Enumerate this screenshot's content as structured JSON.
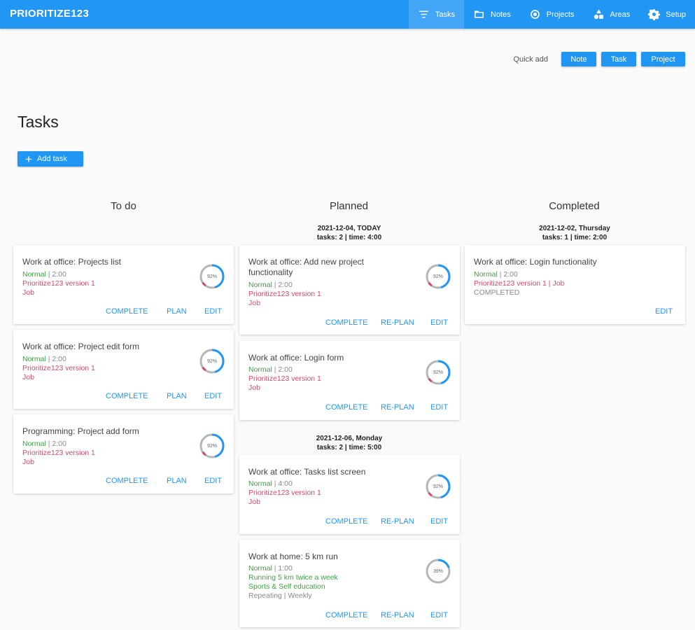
{
  "app": {
    "title": "PRIORITIZE123"
  },
  "nav": [
    {
      "label": "Tasks",
      "icon": "filter-icon",
      "active": true
    },
    {
      "label": "Notes",
      "icon": "folder-icon",
      "active": false
    },
    {
      "label": "Projects",
      "icon": "target-icon",
      "active": false
    },
    {
      "label": "Areas",
      "icon": "shapes-icon",
      "active": false
    },
    {
      "label": "Setup",
      "icon": "gear-icon",
      "active": false
    }
  ],
  "quick_add": {
    "label": "Quick add",
    "buttons": [
      "Note",
      "Task",
      "Project"
    ]
  },
  "page": {
    "title": "Tasks",
    "add_task": "Add task"
  },
  "columns": {
    "todo": "To do",
    "planned": "Planned",
    "completed": "Completed"
  },
  "todo": [
    {
      "title": "Work at office: Projects list",
      "priority": "Normal",
      "sep": " | ",
      "time": "2:00",
      "project": "Prioritize123 version 1",
      "area": "Job",
      "progress": "92%",
      "actions": [
        "COMPLETE",
        "PLAN",
        "EDIT"
      ]
    },
    {
      "title": "Work at office: Project edit form",
      "priority": "Normal",
      "sep": " | ",
      "time": "2:00",
      "project": "Prioritize123 version 1",
      "area": "Job",
      "progress": "92%",
      "actions": [
        "COMPLETE",
        "PLAN",
        "EDIT"
      ]
    },
    {
      "title": "Programming: Project add form",
      "priority": "Normal",
      "sep": " | ",
      "time": "2:00",
      "project": "Prioritize123 version 1",
      "area": "Job",
      "progress": "92%",
      "actions": [
        "COMPLETE",
        "PLAN",
        "EDIT"
      ]
    }
  ],
  "planned_groups": [
    {
      "date": "2021-12-04, TODAY",
      "summary": "tasks: 2 | time: 4:00"
    },
    {
      "date": "2021-12-06, Monday",
      "summary": "tasks: 2 | time: 5:00"
    }
  ],
  "planned": [
    {
      "title_1": "Work at office: Add new project",
      "title_2": "functionality",
      "priority": "Normal",
      "sep": " | ",
      "time": "2:00",
      "project": "Prioritize123 version 1",
      "area": "Job",
      "progress": "92%",
      "actions": [
        "COMPLETE",
        "RE-PLAN",
        "EDIT"
      ]
    },
    {
      "title": "Work at office: Login form",
      "priority": "Normal",
      "sep": " | ",
      "time": "2:00",
      "project": "Prioritize123 version 1",
      "area": "Job",
      "progress": "92%",
      "actions": [
        "COMPLETE",
        "RE-PLAN",
        "EDIT"
      ]
    },
    {
      "title": "Work at office: Tasks list screen",
      "priority": "Normal",
      "sep": " | ",
      "time": "4:00",
      "project": "Prioritize123 version 1",
      "area": "Job",
      "progress": "92%",
      "actions": [
        "COMPLETE",
        "RE-PLAN",
        "EDIT"
      ]
    },
    {
      "title": "Work at home: 5 km run",
      "priority": "Normal",
      "sep": " | ",
      "time": "1:00",
      "project": "Running 5 km twice a week",
      "area": "Sports & Self education",
      "repeat": "Repeating | Weekly",
      "progress": "39%",
      "actions": [
        "COMPLETE",
        "RE-PLAN",
        "EDIT"
      ]
    }
  ],
  "completed_groups": [
    {
      "date": "2021-12-02, Thursday",
      "summary": "tasks: 1 | time: 2:00"
    }
  ],
  "completed": [
    {
      "title": "Work at office: Login functionality",
      "priority": "Normal",
      "sep": " | ",
      "time": "2:00",
      "project_area": "Prioritize123 version 1 | Job",
      "status": "COMPLETED",
      "actions": [
        "EDIT"
      ]
    }
  ],
  "colors": {
    "primary": "#2196f3",
    "green": "#43a047",
    "red": "#d1496b"
  }
}
